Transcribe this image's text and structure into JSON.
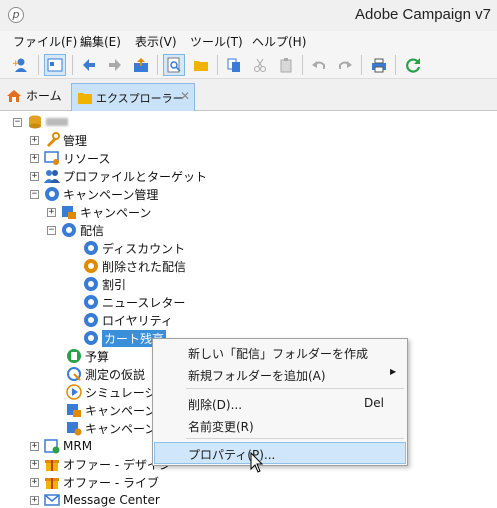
{
  "window": {
    "title": "Adobe Campaign v7",
    "app_icon_glyph": "p"
  },
  "menubar": [
    {
      "label": "ファイル(F)"
    },
    {
      "label": "編集(E)"
    },
    {
      "label": "表示(V)"
    },
    {
      "label": "ツール(T)"
    },
    {
      "label": "ヘルプ(H)"
    }
  ],
  "tabs": {
    "home": "ホーム",
    "explorer": "エクスプローラー",
    "close_glyph": "✕"
  },
  "tree": {
    "root": {
      "label": ""
    },
    "admin": "管理",
    "resources": "リソース",
    "profiles": "プロファイルとターゲット",
    "campaign_mgmt": "キャンペーン管理",
    "campaigns": "キャンペーン",
    "deliveries": "配信",
    "delivery_children": [
      "ディスカウント",
      "削除された配信",
      "割引",
      "ニュースレター",
      "ロイヤリティ"
    ],
    "selected": "カート残高",
    "budget": "予算",
    "hypothesis": "測定の仮説",
    "simulation": "シミュレーション",
    "campaign_x": "キャンペーン",
    "campaign_y": "キャンペーン",
    "mrm": "MRM",
    "offer_design": "オファー - デザイン",
    "offer_live": "オファー - ライブ",
    "message_center": "Message Center"
  },
  "context_menu": {
    "new_folder": "新しい「配信」フォルダーを作成",
    "add_folder": "新規フォルダーを追加(A)",
    "delete": "削除(D)...",
    "delete_shortcut": "Del",
    "rename": "名前変更(R)",
    "properties": "プロパティ(P)..."
  },
  "colors": {
    "accent": "#3b8fd8",
    "highlight": "#cfe6fb",
    "tab_active": "#c9e2f7"
  }
}
